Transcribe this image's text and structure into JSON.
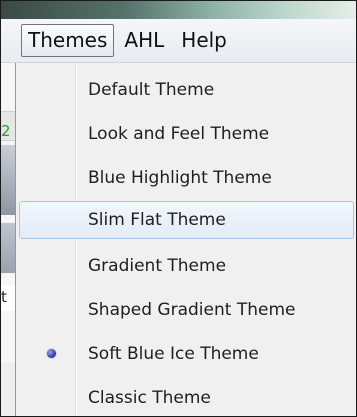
{
  "menubar": {
    "items": [
      {
        "label": "Themes",
        "active": true
      },
      {
        "label": "AHL",
        "active": false
      },
      {
        "label": "Help",
        "active": false
      }
    ]
  },
  "underlay": {
    "glyph_1": "2",
    "glyph_2": "t"
  },
  "themes_menu": {
    "items": [
      {
        "label": "Default Theme",
        "selected": false,
        "hovered": false
      },
      {
        "label": "Look and Feel Theme",
        "selected": false,
        "hovered": false
      },
      {
        "label": "Blue Highlight Theme",
        "selected": false,
        "hovered": false
      },
      {
        "label": "Slim Flat Theme",
        "selected": false,
        "hovered": true
      },
      {
        "label": "Gradient Theme",
        "selected": false,
        "hovered": false
      },
      {
        "label": "Shaped Gradient Theme",
        "selected": false,
        "hovered": false
      },
      {
        "label": "Soft Blue Ice Theme",
        "selected": true,
        "hovered": false
      },
      {
        "label": "Classic Theme",
        "selected": false,
        "hovered": false
      }
    ],
    "selected_indicator_icon": "radio-dot-icon"
  },
  "colors": {
    "hover_border": "#a8c4e6",
    "radio_dot": "#3b46b3",
    "menu_background": "#f0f0f0"
  }
}
